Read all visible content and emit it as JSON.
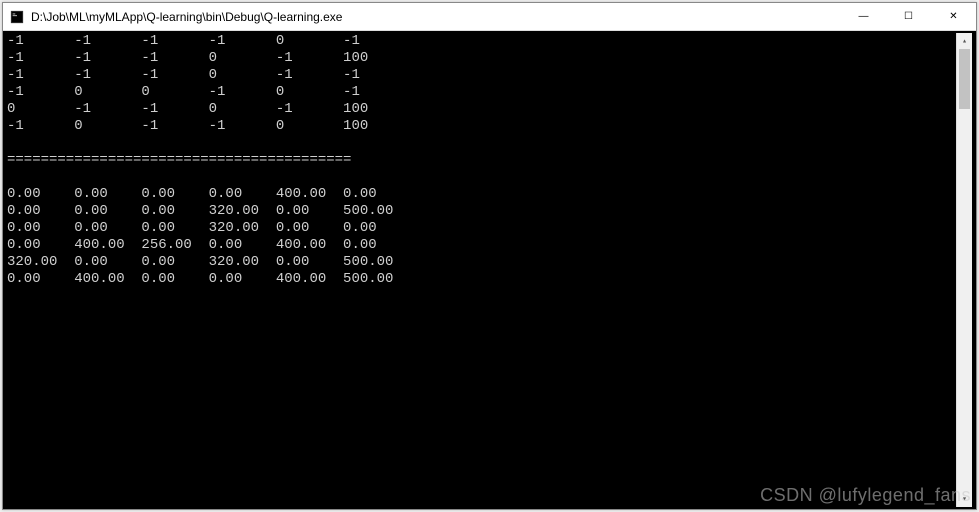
{
  "window": {
    "title": "D:\\Job\\ML\\myMLApp\\Q-learning\\bin\\Debug\\Q-learning.exe",
    "icon_name": "console-app-icon"
  },
  "controls": {
    "minimize": "—",
    "maximize": "☐",
    "close": "✕"
  },
  "scrollbar": {
    "up": "▴",
    "down": "▾"
  },
  "console": {
    "r_matrix": [
      [
        "-1",
        "-1",
        "-1",
        "-1",
        "0",
        "-1"
      ],
      [
        "-1",
        "-1",
        "-1",
        "0",
        "-1",
        "100"
      ],
      [
        "-1",
        "-1",
        "-1",
        "0",
        "-1",
        "-1"
      ],
      [
        "-1",
        "0",
        "0",
        "-1",
        "0",
        "-1"
      ],
      [
        "0",
        "-1",
        "-1",
        "0",
        "-1",
        "100"
      ],
      [
        "-1",
        "0",
        "-1",
        "-1",
        "0",
        "100"
      ]
    ],
    "separator": "=========================================",
    "q_matrix": [
      [
        "0.00",
        "0.00",
        "0.00",
        "0.00",
        "400.00",
        "0.00"
      ],
      [
        "0.00",
        "0.00",
        "0.00",
        "320.00",
        "0.00",
        "500.00"
      ],
      [
        "0.00",
        "0.00",
        "0.00",
        "320.00",
        "0.00",
        "0.00"
      ],
      [
        "0.00",
        "400.00",
        "256.00",
        "0.00",
        "400.00",
        "0.00"
      ],
      [
        "320.00",
        "0.00",
        "0.00",
        "320.00",
        "0.00",
        "500.00"
      ],
      [
        "0.00",
        "400.00",
        "0.00",
        "0.00",
        "400.00",
        "500.00"
      ]
    ]
  },
  "watermark": "CSDN @lufylegend_fans"
}
